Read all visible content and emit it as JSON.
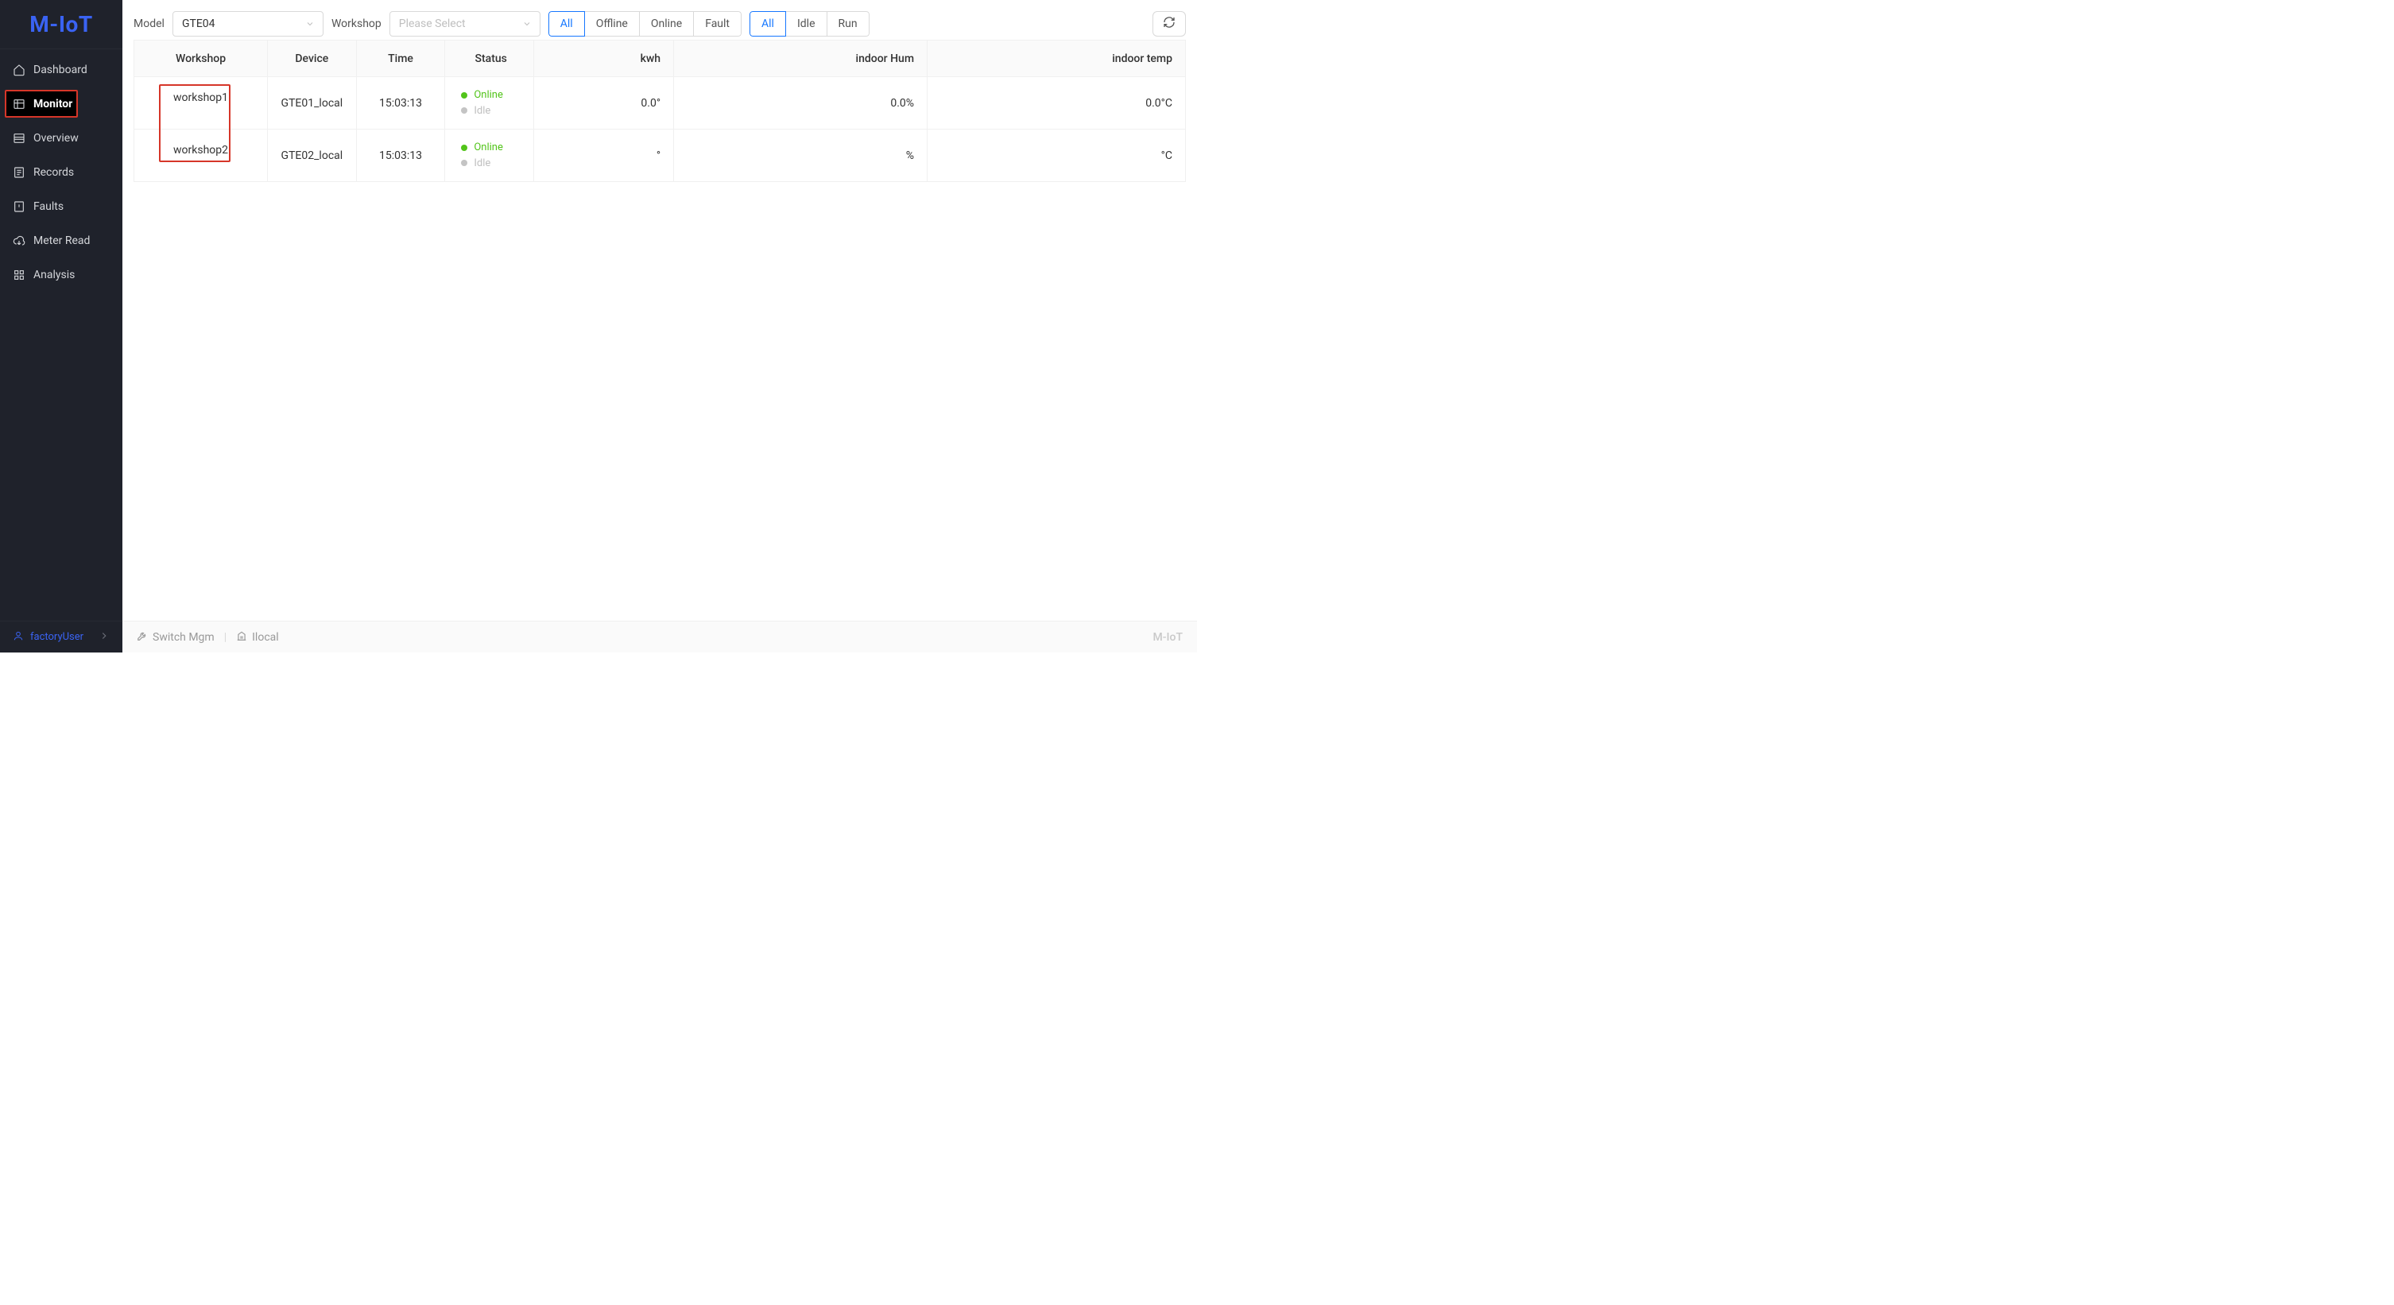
{
  "app": {
    "logo": "M-IoT",
    "brand_footer": "M-IoT"
  },
  "sidebar": {
    "items": [
      {
        "label": "Dashboard"
      },
      {
        "label": "Monitor"
      },
      {
        "label": "Overview"
      },
      {
        "label": "Records"
      },
      {
        "label": "Faults"
      },
      {
        "label": "Meter Read"
      },
      {
        "label": "Analysis"
      }
    ],
    "user": "factoryUser"
  },
  "filters": {
    "model_label": "Model",
    "model_value": "GTE04",
    "workshop_label": "Workshop",
    "workshop_placeholder": "Please Select",
    "status_group": [
      "All",
      "Offline",
      "Online",
      "Fault"
    ],
    "status_active": "All",
    "state_group": [
      "All",
      "Idle",
      "Run"
    ],
    "state_active": "All"
  },
  "table": {
    "columns": {
      "workshop": "Workshop",
      "device": "Device",
      "time": "Time",
      "status": "Status",
      "kwh": "kwh",
      "hum": "indoor Hum",
      "temp": "indoor temp"
    },
    "rows": [
      {
        "workshop": "workshop1",
        "device": "GTE01_local",
        "time": "15:03:13",
        "status": [
          {
            "dot": "green",
            "text": "Online",
            "cls": "txt-green"
          },
          {
            "dot": "gray",
            "text": "Idle",
            "cls": "txt-gray"
          }
        ],
        "kwh": "0.0°",
        "hum": "0.0%",
        "temp": "0.0°C"
      },
      {
        "workshop": "workshop2",
        "device": "GTE02_local",
        "time": "15:03:13",
        "status": [
          {
            "dot": "green",
            "text": "Online",
            "cls": "txt-green"
          },
          {
            "dot": "gray",
            "text": "Idle",
            "cls": "txt-gray"
          }
        ],
        "kwh": "°",
        "hum": "%",
        "temp": "°C"
      }
    ]
  },
  "statusbar": {
    "switch": "Switch Mgm",
    "local": "Ilocal"
  }
}
